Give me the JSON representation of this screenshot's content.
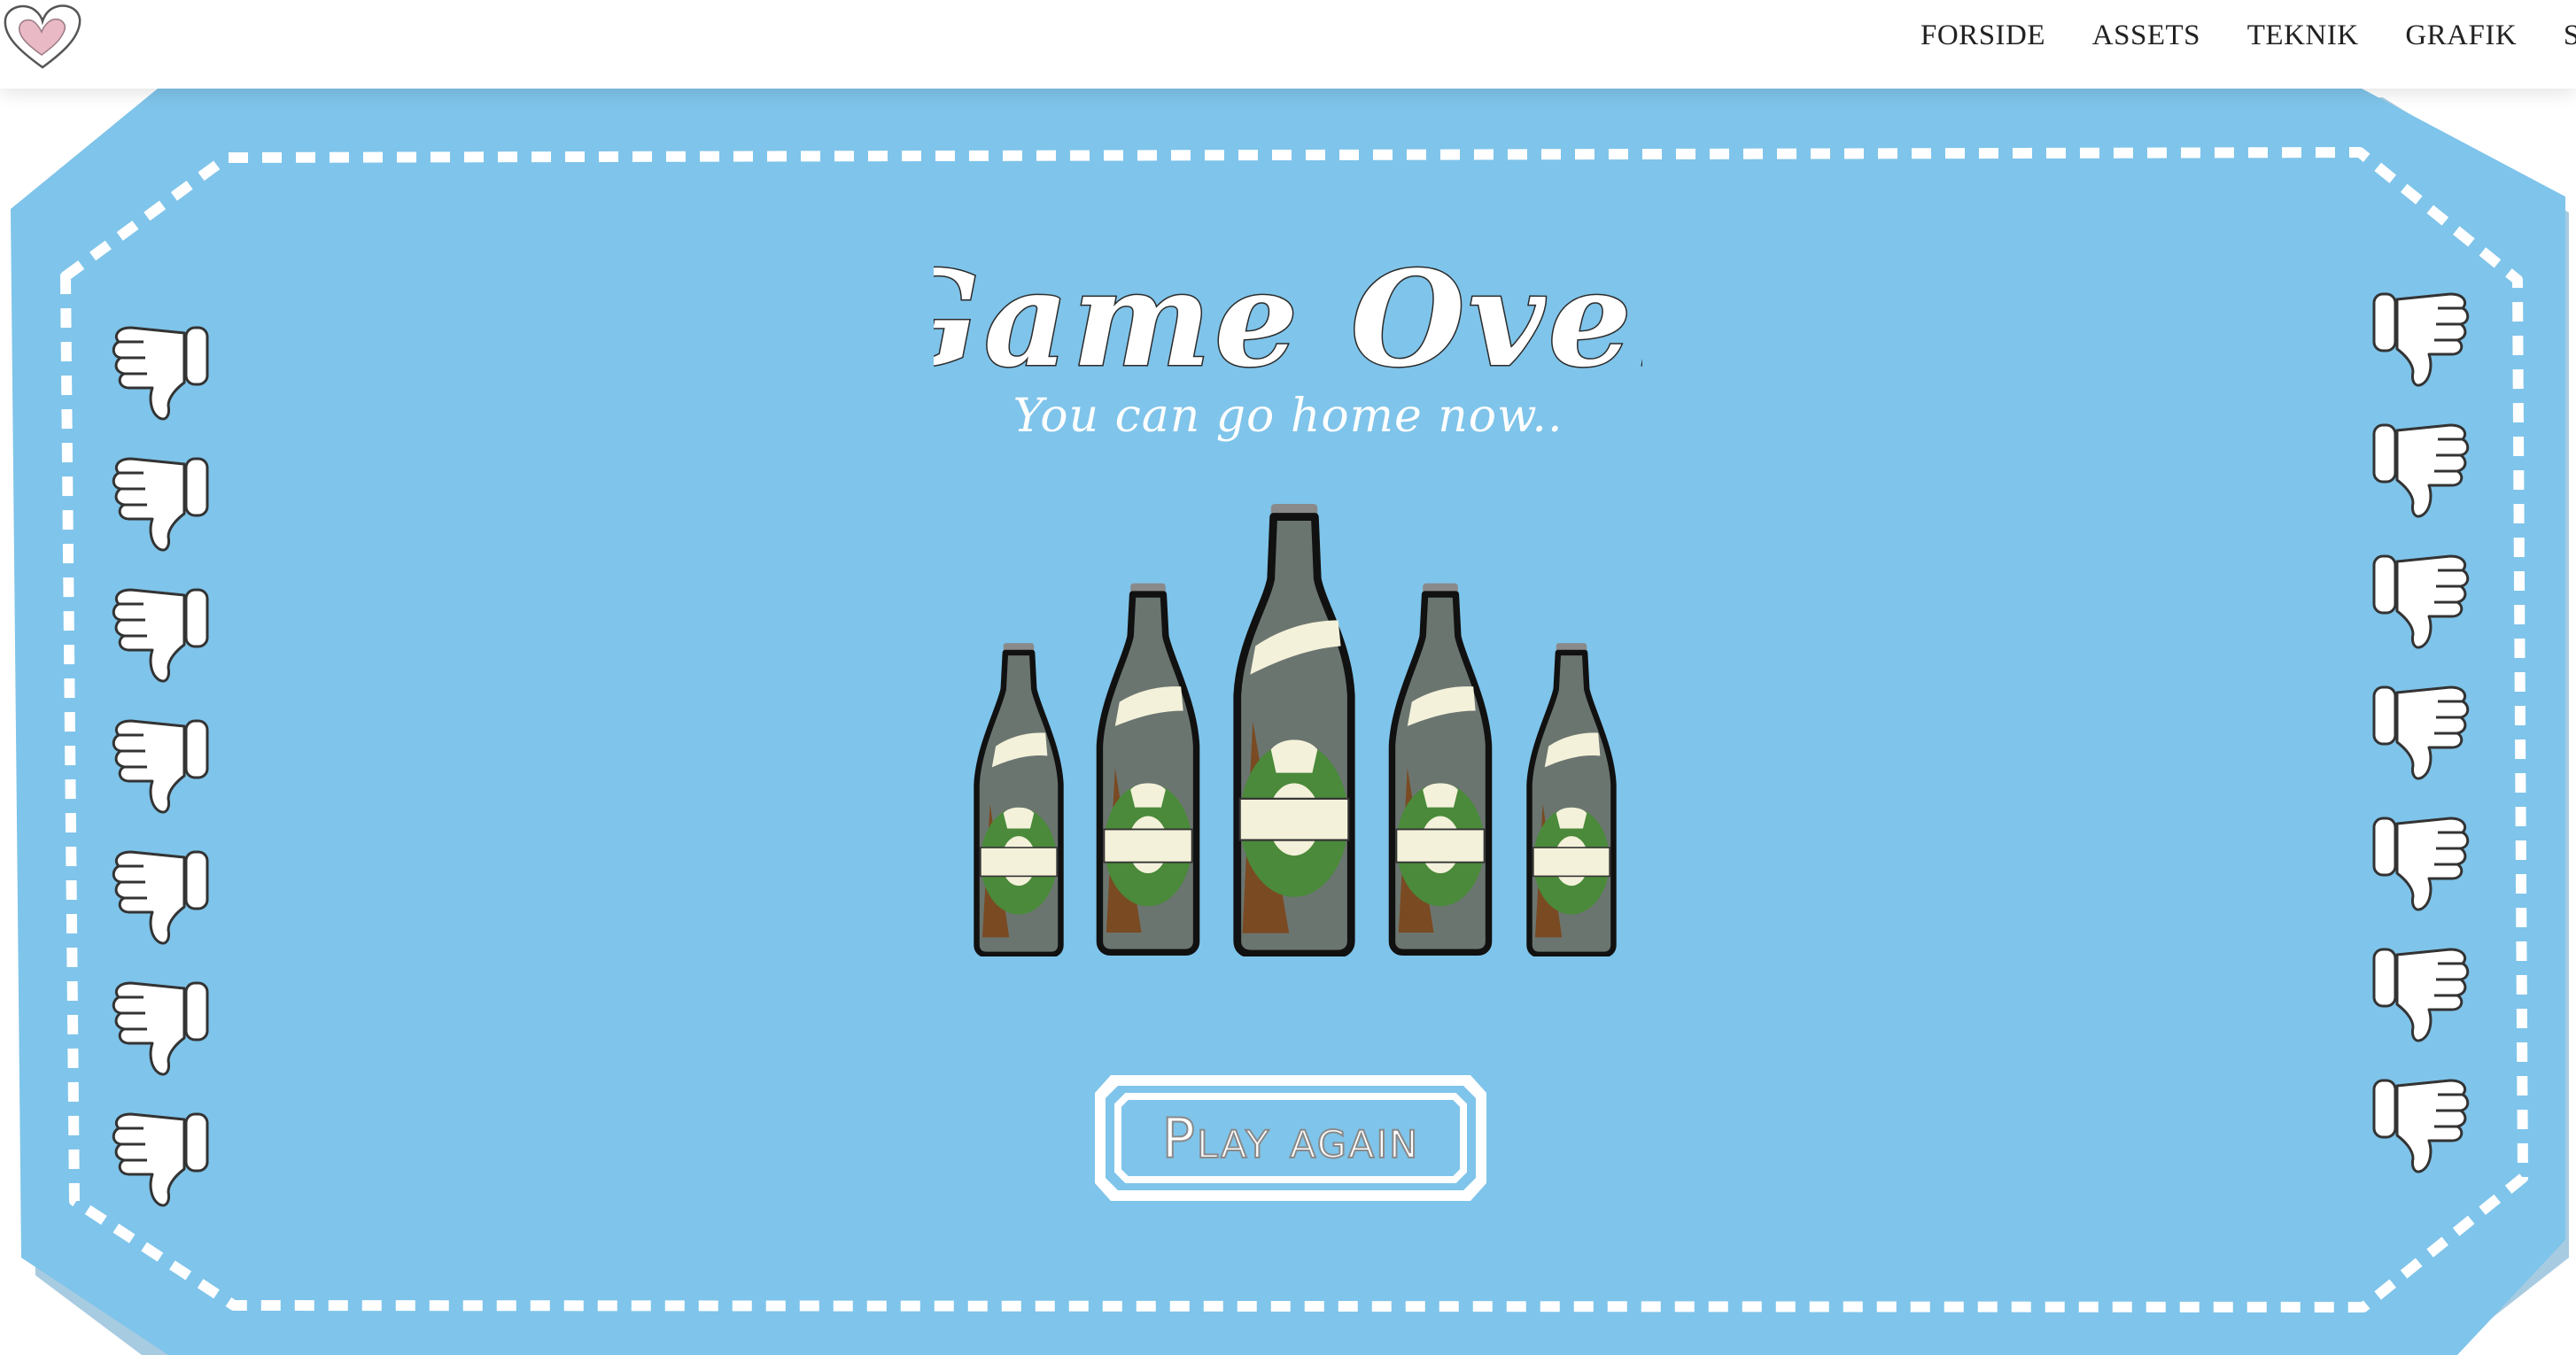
{
  "nav": {
    "items": [
      "FORSIDE",
      "ASSETS",
      "TEKNIK",
      "GRAFIK",
      "SPIL"
    ]
  },
  "game_over": {
    "title": "Game Over",
    "subtitle": "You can go home now..",
    "play_again_label": "Play again",
    "left_thumbs_down_count": 7,
    "right_thumbs_down_count": 7,
    "bottle_count": 5
  },
  "colors": {
    "board": "#7fc4ea",
    "board_dark": "#64a9d1",
    "dashes": "#ffffff",
    "bottle_glass": "#6b7570",
    "bottle_label_cream": "#f4f1da",
    "bottle_label_green": "#4a8a3a",
    "bottle_brown": "#7a4a22",
    "logo_heart": "#e9b9c6"
  },
  "icons": {
    "logo": "heart-icon",
    "left_hands": "thumbs-down-icon",
    "right_hands": "thumbs-down-icon"
  }
}
